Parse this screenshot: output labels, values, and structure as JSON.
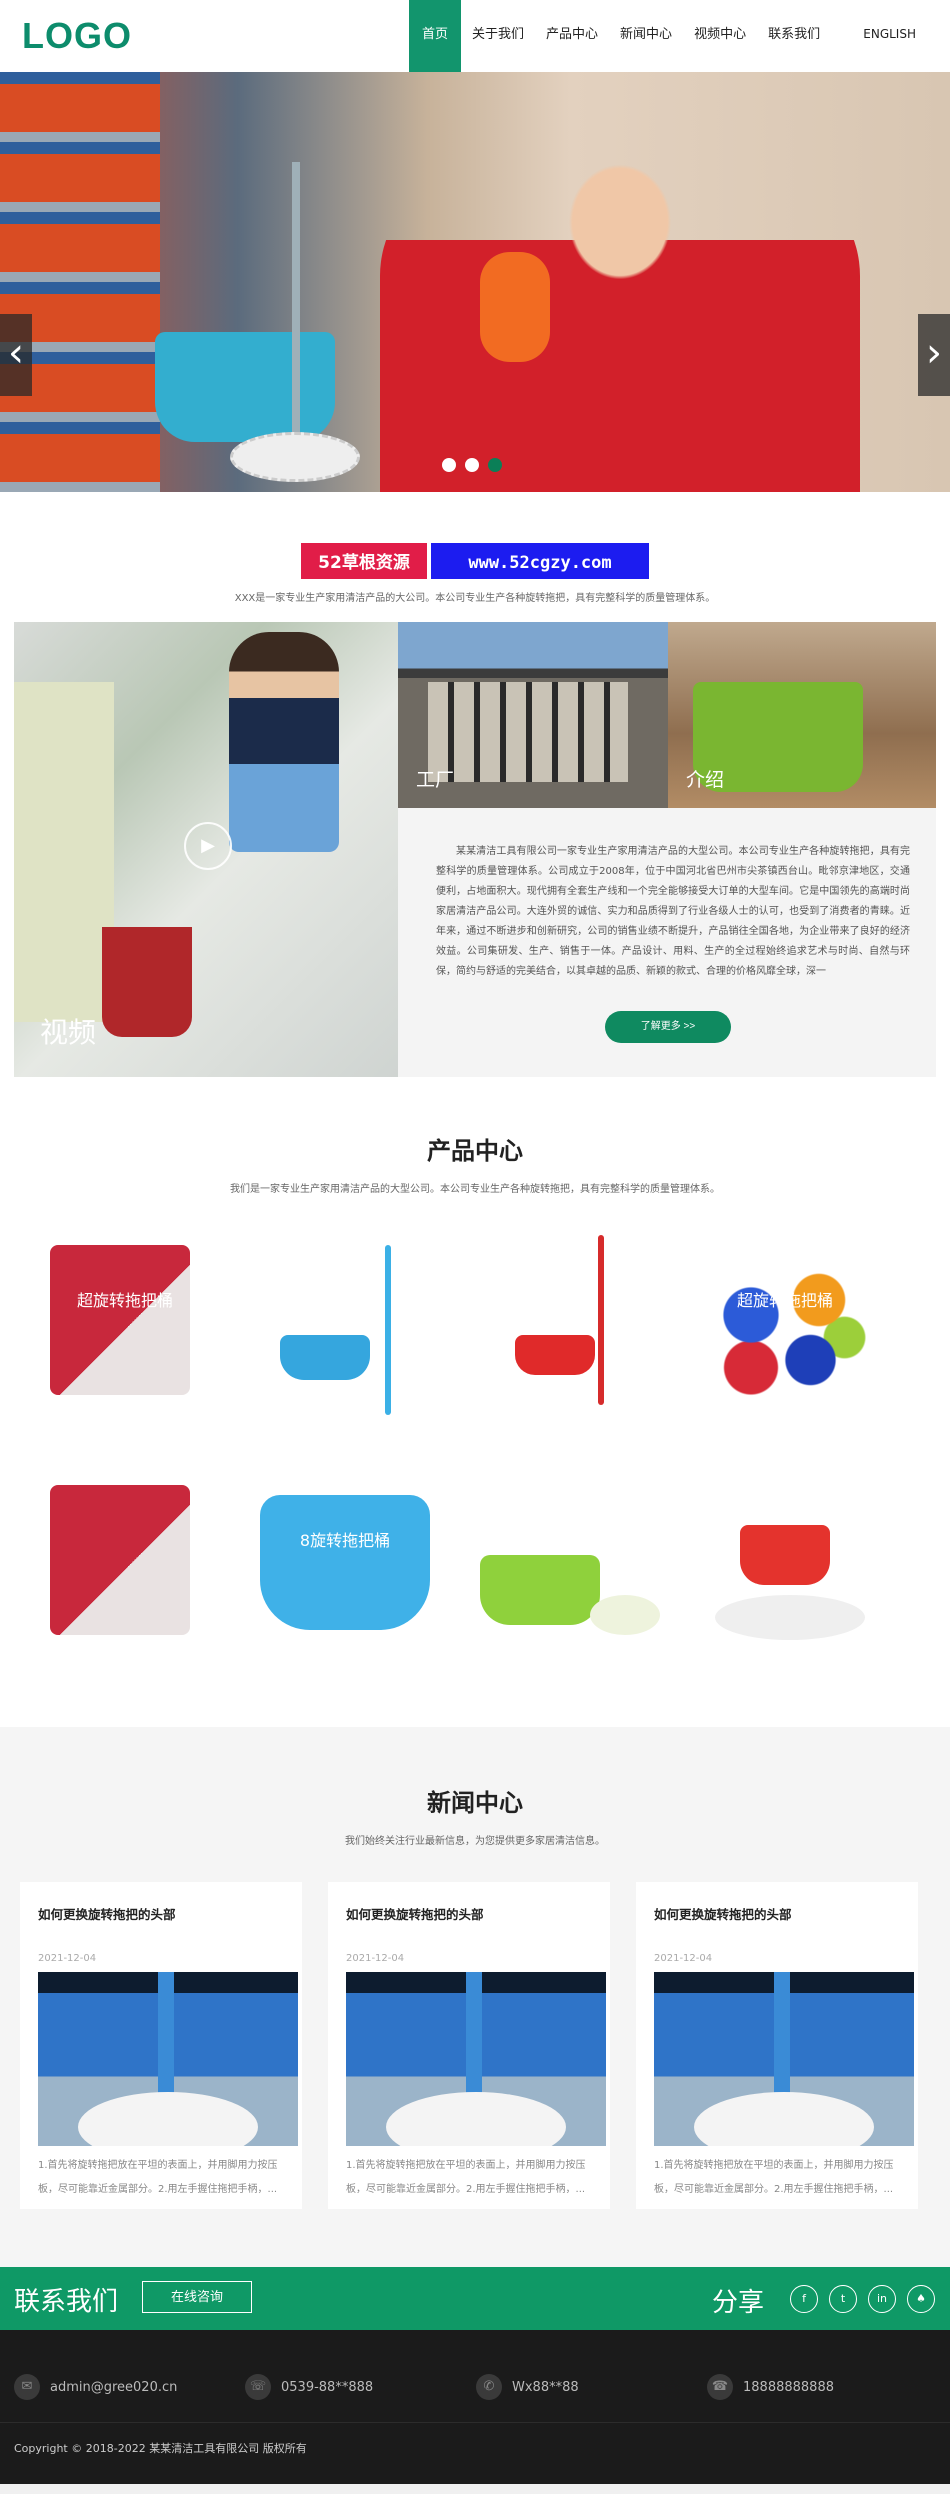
{
  "header": {
    "logo": "LOGO",
    "lang": "ENGLISH",
    "nav": [
      "首页",
      "关于我们",
      "产品中心",
      "新闻中心",
      "视频中心",
      "联系我们"
    ]
  },
  "banner": {
    "prev": "‹",
    "next": "›",
    "slides": 3,
    "active_slide": 3
  },
  "about": {
    "watermark_1": "52草根资源",
    "watermark_2": "www.52cgzy.com",
    "subtitle": "XXX是一家专业生产家用清洁产品的大公司。本公司专业生产各种旋转拖把，具有完整科学的质量管理体系。",
    "video_label": "视频",
    "factory_label": "工厂",
    "intro_label": "介绍",
    "text": "某某清洁工具有限公司一家专业生产家用清洁产品的大型公司。本公司专业生产各种旋转拖把，具有完整科学的质量管理体系。公司成立于2008年，位于中国河北省巴州市尖茶镇西台山。毗邻京津地区，交通便利，占地面积大。现代拥有全套生产线和一个完全能够接受大订单的大型车间。它是中国领先的高端时尚家居清洁产品公司。大连外贸的诚信、实力和品质得到了行业各级人士的认可，也受到了消费者的青睐。近年来，通过不断进步和创新研究，公司的销售业绩不断提升，产品销往全国各地，为企业带来了良好的经济效益。公司集研发、生产、销售于一体。产品设计、用料、生产的全过程始终追求艺术与时尚、自然与环保，简约与舒适的完美结合，以其卓越的品质、新颖的款式、合理的价格风靡全球，深一",
    "more": "了解更多 >>"
  },
  "products": {
    "title": "产品中心",
    "subtitle": "我们是一家专业生产家用清洁产品的大型公司。本公司专业生产各种旋转拖把，具有完整科学的质量管理体系。",
    "captions": [
      "超旋转拖把桶",
      "",
      "",
      "超旋转拖把桶",
      "",
      "8旋转拖把桶",
      "",
      ""
    ]
  },
  "news": {
    "title": "新闻中心",
    "subtitle": "我们始终关注行业最新信息，为您提供更多家居清洁信息。",
    "items": [
      {
        "title": "如何更换旋转拖把的头部",
        "date": "2021-12-04",
        "text": "1.首先将旋转拖把放在平坦的表面上，并用脚用力按压板，尽可能靠近金属部分。2.用左手握住拖把手柄，..."
      },
      {
        "title": "如何更换旋转拖把的头部",
        "date": "2021-12-04",
        "text": "1.首先将旋转拖把放在平坦的表面上，并用脚用力按压板，尽可能靠近金属部分。2.用左手握住拖把手柄，..."
      },
      {
        "title": "如何更换旋转拖把的头部",
        "date": "2021-12-04",
        "text": "1.首先将旋转拖把放在平坦的表面上，并用脚用力按压板，尽可能靠近金属部分。2.用左手握住拖把手柄，..."
      }
    ]
  },
  "contact": {
    "title": "联系我们",
    "button": "在线咨询",
    "share": "分享",
    "social": [
      "f",
      "t",
      "in",
      "♠"
    ]
  },
  "footer": {
    "email": "admin@gree020.cn",
    "phone": "0539-88**888",
    "wechat": "Wx88**88",
    "mobile": "18888888888",
    "copyright": "Copyright © 2018-2022 某某清洁工具有限公司 版权所有"
  },
  "colors": {
    "brand": "#12956d",
    "footer": "#1b1b1b"
  }
}
